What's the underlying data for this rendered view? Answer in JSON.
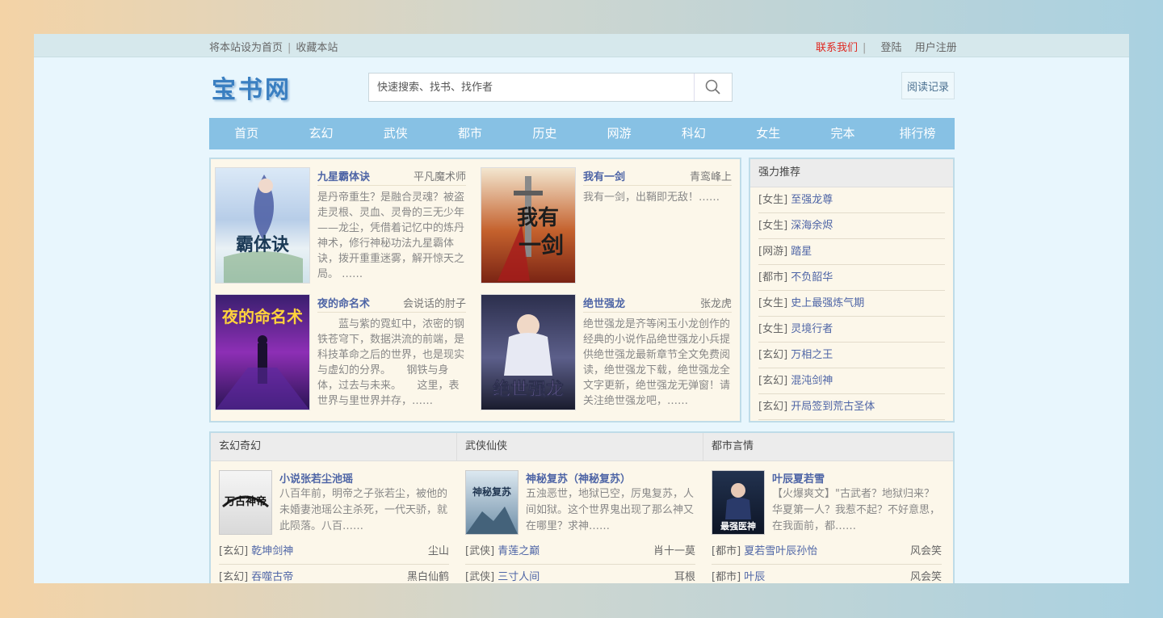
{
  "topbar": {
    "set_home": "将本站设为首页",
    "bookmark": "收藏本站",
    "contact": "联系我们",
    "login": "登陆",
    "register": "用户注册"
  },
  "header": {
    "logo": "宝书网",
    "search_placeholder": "快速搜索、找书、找作者",
    "history": "阅读记录"
  },
  "nav": [
    "首页",
    "玄幻",
    "武侠",
    "都市",
    "历史",
    "网游",
    "科幻",
    "女生",
    "完本",
    "排行榜"
  ],
  "featured": [
    {
      "title": "九星霸体诀",
      "author": "平凡魔术师",
      "desc": "是丹帝重生？是融合灵魂？被盗走灵根、灵血、灵骨的三无少年——龙尘，凭借着记忆中的炼丹神术，修行神秘功法九星霸体诀，拨开重重迷雾，解开惊天之局。 ……",
      "cover_text": "霸体诀"
    },
    {
      "title": "我有一剑",
      "author": "青鸾峰上",
      "desc": "我有一剑，出鞘即无敌！……",
      "cover_text": "我有一剑"
    },
    {
      "title": "夜的命名术",
      "author": "会说话的肘子",
      "desc": "　　蓝与紫的霓虹中，浓密的钢铁苍穹下，数据洪流的前端，是科技革命之后的世界，也是现实与虚幻的分界。　　钢铁与身体，过去与未来。　　这里，表世界与里世界并存，……",
      "cover_text": "夜的命名术"
    },
    {
      "title": "绝世强龙",
      "author": "张龙虎",
      "desc": "绝世强龙是齐等闲玉小龙创作的经典的小说作品绝世强龙小兵提供绝世强龙最新章节全文免费阅读，绝世强龙下载，绝世强龙全文字更新，绝世强龙无弹窗！请关注绝世强龙吧，……",
      "cover_text": "绝世强龙"
    }
  ],
  "recommend": {
    "title": "强力推荐",
    "items": [
      {
        "cat": "[女生]",
        "name": "至强龙尊"
      },
      {
        "cat": "[女生]",
        "name": "深海余烬"
      },
      {
        "cat": "[网游]",
        "name": "踏星"
      },
      {
        "cat": "[都市]",
        "name": "不负韶华"
      },
      {
        "cat": "[女生]",
        "name": "史上最强炼气期"
      },
      {
        "cat": "[女生]",
        "name": "灵境行者"
      },
      {
        "cat": "[玄幻]",
        "name": "万相之王"
      },
      {
        "cat": "[玄幻]",
        "name": "混沌剑神"
      },
      {
        "cat": "[玄幻]",
        "name": "开局签到荒古圣体"
      }
    ]
  },
  "categories": [
    {
      "head": "玄幻奇幻",
      "top": {
        "title": "小说张若尘池瑶",
        "desc": "八百年前，明帝之子张若尘，被他的未婚妻池瑶公主杀死，一代天骄，就此陨落。八百……",
        "cover_text": "万古神帝"
      },
      "rows": [
        {
          "cat": "[玄幻]",
          "name": "乾坤剑神",
          "author": "尘山"
        },
        {
          "cat": "[玄幻]",
          "name": "吞噬古帝",
          "author": "黑白仙鹤"
        }
      ]
    },
    {
      "head": "武侠仙侠",
      "top": {
        "title": "神秘复苏（神秘复苏）",
        "desc": "五浊恶世，地狱已空，厉鬼复苏，人间如狱。这个世界鬼出现了那么神又在哪里？求神……",
        "cover_text": "神秘复苏"
      },
      "rows": [
        {
          "cat": "[武侠]",
          "name": "青莲之巅",
          "author": "肖十一莫"
        },
        {
          "cat": "[武侠]",
          "name": "三寸人间",
          "author": "耳根"
        }
      ]
    },
    {
      "head": "都市言情",
      "top": {
        "title": "叶辰夏若雪",
        "desc": "【火爆爽文】\"古武者？地狱归来？华夏第一人？我惹不起？不好意思，在我面前，都……",
        "cover_text": "最强医神"
      },
      "rows": [
        {
          "cat": "[都市]",
          "name": "夏若雪叶辰孙怡",
          "author": "风会笑"
        },
        {
          "cat": "[都市]",
          "name": "叶辰",
          "author": "风会笑"
        }
      ]
    }
  ]
}
